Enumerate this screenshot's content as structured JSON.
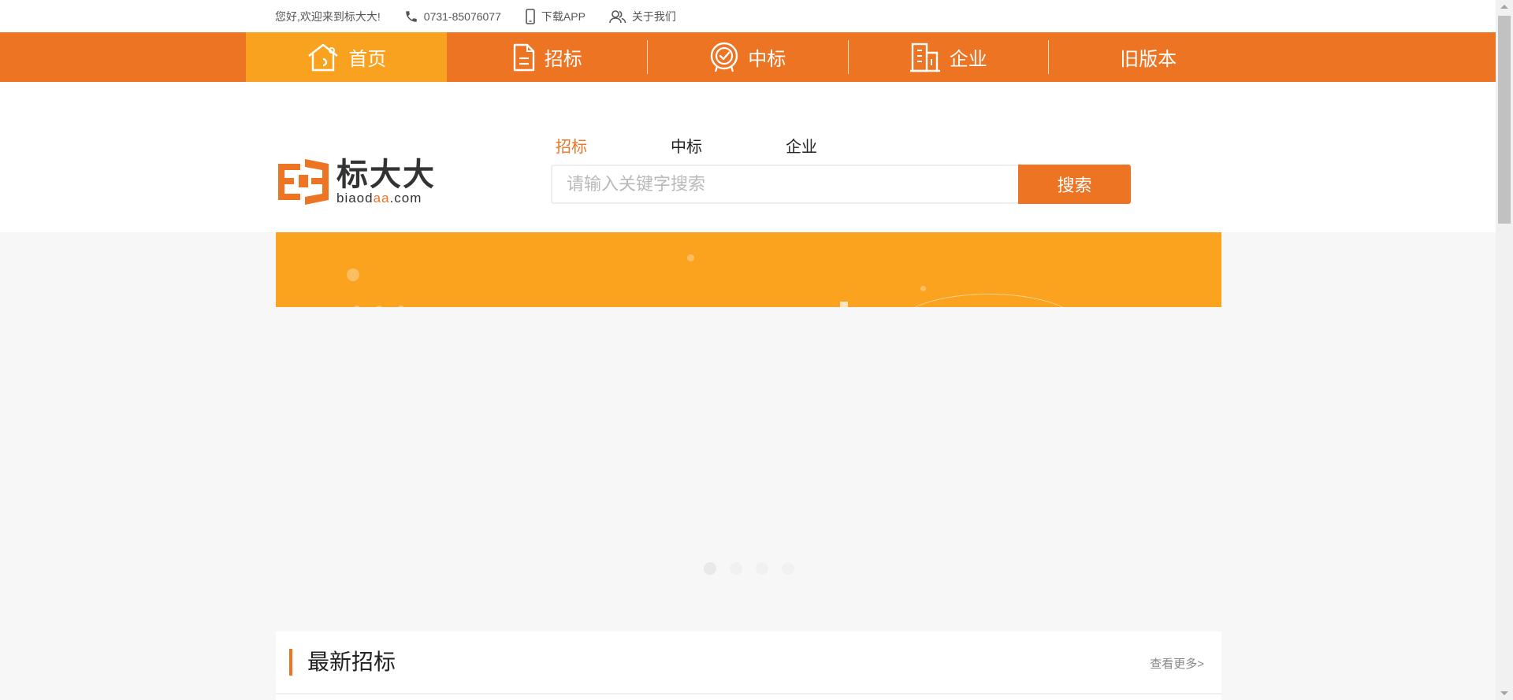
{
  "topbar": {
    "greeting": "您好,欢迎来到标大大!",
    "phone": "0731-85076077",
    "download": "下载APP",
    "about": "关于我们"
  },
  "nav": {
    "items": [
      {
        "label": "首页",
        "icon": "home-icon"
      },
      {
        "label": "招标",
        "icon": "document-icon"
      },
      {
        "label": "中标",
        "icon": "award-icon"
      },
      {
        "label": "企业",
        "icon": "building-icon"
      },
      {
        "label": "旧版本",
        "icon": ""
      }
    ],
    "active_index": 0
  },
  "logo": {
    "name_cn": "标大大",
    "domain_prefix": "biaod",
    "domain_highlight": "aa",
    "domain_suffix": ".com"
  },
  "search": {
    "tabs": [
      "招标",
      "中标",
      "企业"
    ],
    "active_tab": 0,
    "placeholder": "请输入关键字搜索",
    "value": "",
    "button_label": "搜索"
  },
  "carousel": {
    "dot_count": 4,
    "active_index": 0
  },
  "section": {
    "title": "最新招标",
    "more_label": "查看更多>"
  },
  "colors": {
    "brand_orange": "#ec7423",
    "nav_active": "#f8a21f",
    "banner": "#fba31f"
  }
}
